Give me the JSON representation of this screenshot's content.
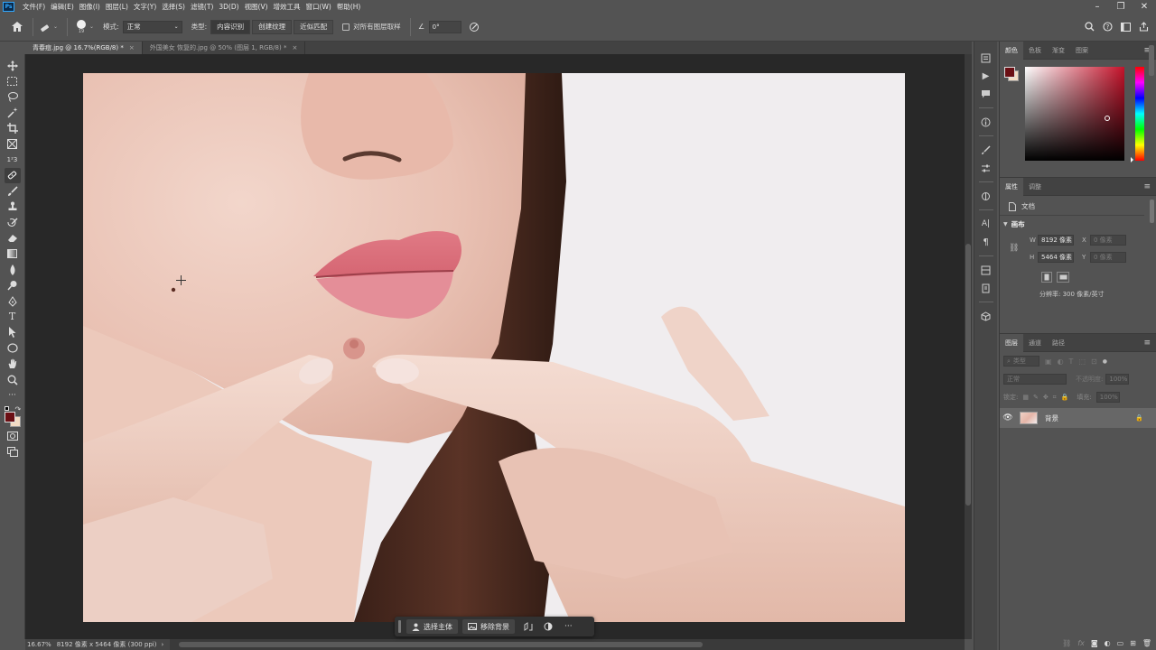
{
  "menubar": {
    "app_icon": "Ps",
    "items": [
      "文件(F)",
      "编辑(E)",
      "图像(I)",
      "图层(L)",
      "文字(Y)",
      "选择(S)",
      "滤镜(T)",
      "3D(D)",
      "视图(V)",
      "增效工具",
      "窗口(W)",
      "帮助(H)"
    ]
  },
  "optbar": {
    "brush_size": "19",
    "mode_label": "模式:",
    "mode_value": "正常",
    "type_label": "类型:",
    "type_buttons": [
      "内容识别",
      "创建纹理",
      "近似匹配"
    ],
    "sample_all_layers": "对所有图层取样",
    "angle_value": "0°"
  },
  "tabs": [
    {
      "label": "青春痘.jpg @ 16.7%(RGB/8) *",
      "close": "×"
    },
    {
      "label": "外国美女 恢复的.jpg @ 50% (图层 1, RGB/8) *",
      "close": "×"
    }
  ],
  "status": {
    "zoom": "16.67%",
    "doc_info": "8192 像素 x 5464 像素 (300 ppi)",
    "arrow": "›"
  },
  "context_bar": {
    "select_subject": "选择主体",
    "remove_bg": "移除背景",
    "more": "···"
  },
  "color_panel": {
    "tabs": [
      "颜色",
      "色板",
      "渐变",
      "图案"
    ],
    "fg_color": "#6b0f14",
    "bg_color": "#f3dcc4",
    "hue_color": "#c4122a"
  },
  "properties_panel": {
    "tabs": [
      "属性",
      "调整"
    ],
    "doc_label": "文档",
    "section": "画布",
    "w_label": "W",
    "w_value": "8192 像素",
    "h_label": "H",
    "h_value": "5464 像素",
    "x_label": "X",
    "x_placeholder": "0 像素",
    "y_label": "Y",
    "y_placeholder": "0 像素",
    "resolution": "分辨率: 300 像素/英寸"
  },
  "layers_panel": {
    "tabs": [
      "图层",
      "通道",
      "路径"
    ],
    "kind_filter": "类型",
    "blend_mode": "正常",
    "opacity_label": "不透明度:",
    "opacity_value": "100%",
    "lock_label": "锁定:",
    "fill_label": "填充:",
    "fill_value": "100%",
    "layer_name": "背景"
  }
}
